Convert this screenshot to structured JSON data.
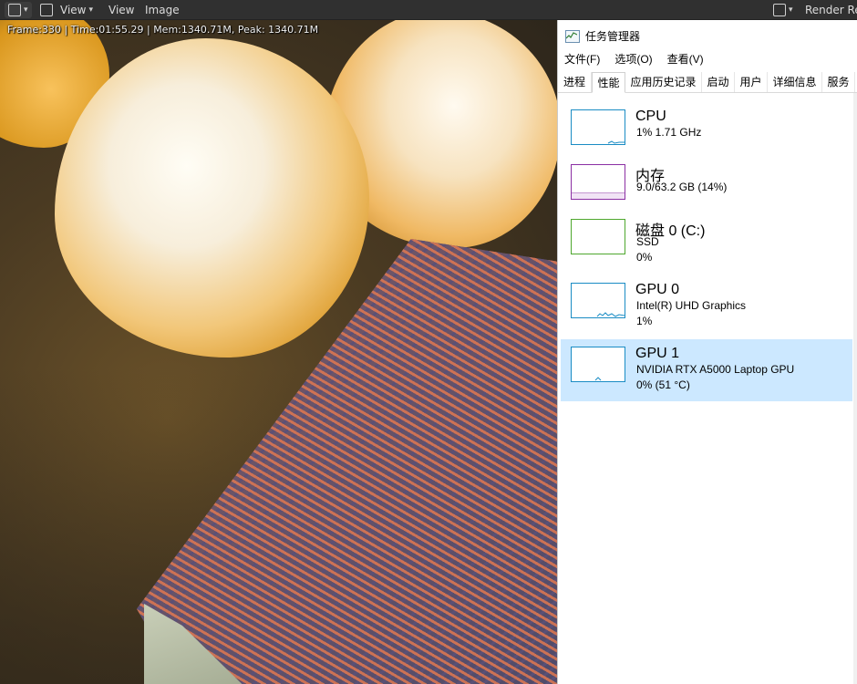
{
  "blender": {
    "menu_view1": "View",
    "menu_view2": "View",
    "menu_image": "Image",
    "render_result": "Render Res",
    "stats": "Frame:330 | Time:01:55.29 | Mem:1340.71M, Peak: 1340.71M"
  },
  "taskmgr": {
    "title": "任务管理器",
    "menu": [
      "文件(F)",
      "选项(O)",
      "查看(V)"
    ],
    "tabs": [
      "进程",
      "性能",
      "应用历史记录",
      "启动",
      "用户",
      "详细信息",
      "服务"
    ],
    "active_tab": "性能",
    "items": [
      {
        "name": "CPU",
        "line1": "1% 1.71 GHz",
        "line2": "",
        "color": "#1a8cc4"
      },
      {
        "name": "内存",
        "line1": "9.0/63.2 GB (14%)",
        "line2": "",
        "color": "#8b2fa3"
      },
      {
        "name": "磁盘 0 (C:)",
        "line1": "SSD",
        "line2": "0%",
        "color": "#4ea72e"
      },
      {
        "name": "GPU 0",
        "line1": "Intel(R) UHD Graphics",
        "line2": "1%",
        "color": "#1a8cc4"
      },
      {
        "name": "GPU 1",
        "line1": "NVIDIA RTX A5000 Laptop GPU",
        "line2": "0% (51 °C)",
        "color": "#1a8cc4"
      }
    ],
    "selected_item": "GPU 1"
  }
}
